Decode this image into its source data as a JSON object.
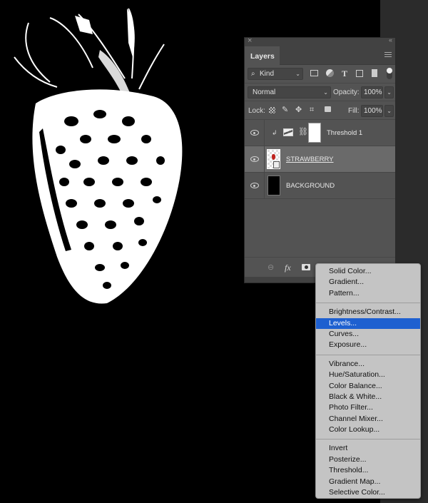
{
  "canvas": {
    "subject": "threshold strawberry image",
    "background_color": "#000000"
  },
  "layers_panel": {
    "close_glyph": "×",
    "collapse_glyph": "‹‹",
    "tab_label": "Layers",
    "filter": {
      "search_glyph": "⌕",
      "kind_label": "Kind",
      "filter_icons": [
        "image-filter-icon",
        "adjustment-filter-icon",
        "type-filter-icon",
        "shape-filter-icon",
        "smart-object-filter-icon"
      ]
    },
    "blend_mode": "Normal",
    "opacity_label": "Opacity:",
    "opacity_value": "100%",
    "lock_label": "Lock:",
    "fill_label": "Fill:",
    "fill_value": "100%",
    "layers": [
      {
        "name": "Threshold 1",
        "type": "adjustment",
        "visible": true,
        "clipped": true,
        "selected": false
      },
      {
        "name": "STRAWBERRY",
        "type": "smart-object",
        "visible": true,
        "selected": true
      },
      {
        "name": "BACKGROUND",
        "type": "pixel",
        "visible": true,
        "selected": false
      }
    ],
    "footer": {
      "link_glyph": "⊖",
      "fx_label": "fx"
    }
  },
  "adjustment_menu": {
    "groups": [
      [
        "Solid Color...",
        "Gradient...",
        "Pattern..."
      ],
      [
        "Brightness/Contrast...",
        "Levels...",
        "Curves...",
        "Exposure..."
      ],
      [
        "Vibrance...",
        "Hue/Saturation...",
        "Color Balance...",
        "Black & White...",
        "Photo Filter...",
        "Channel Mixer...",
        "Color Lookup..."
      ],
      [
        "Invert",
        "Posterize...",
        "Threshold...",
        "Gradient Map...",
        "Selective Color..."
      ]
    ],
    "highlighted": "Levels...",
    "highlight_color": "#1e60d0"
  }
}
